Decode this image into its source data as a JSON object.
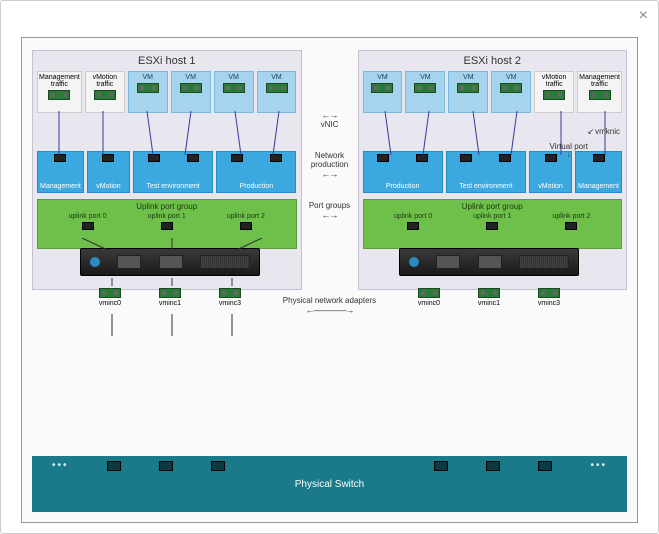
{
  "close": "×",
  "hosts": [
    {
      "title": "ESXi host 1",
      "top": [
        {
          "label": "Management traffic",
          "type": "wh"
        },
        {
          "label": "vMotion traffic",
          "type": "wh"
        },
        {
          "label": "VM",
          "type": "bl"
        },
        {
          "label": "VM",
          "type": "bl"
        },
        {
          "label": "VM",
          "type": "bl"
        },
        {
          "label": "VM",
          "type": "bl"
        }
      ],
      "portgroups": [
        {
          "label": "Management",
          "ports": 1
        },
        {
          "label": "vMotion",
          "ports": 1
        },
        {
          "label": "Test environment",
          "ports": 2
        },
        {
          "label": "Production",
          "ports": 2
        }
      ],
      "uplink": {
        "title": "Uplink port group",
        "items": [
          "uplink port 0",
          "uplink port 1",
          "uplink port 2"
        ]
      }
    },
    {
      "title": "ESXi host 2",
      "top": [
        {
          "label": "VM",
          "type": "bl"
        },
        {
          "label": "VM",
          "type": "bl"
        },
        {
          "label": "VM",
          "type": "bl"
        },
        {
          "label": "VM",
          "type": "bl"
        },
        {
          "label": "vMotion traffic",
          "type": "wh"
        },
        {
          "label": "Management traffic",
          "type": "wh"
        }
      ],
      "portgroups": [
        {
          "label": "Production",
          "ports": 2
        },
        {
          "label": "Test environment",
          "ports": 2
        },
        {
          "label": "vMotion",
          "ports": 1
        },
        {
          "label": "Management",
          "ports": 1
        }
      ],
      "uplink": {
        "title": "Uplink port group",
        "items": [
          "uplink port 0",
          "uplink port 1",
          "uplink port 2"
        ]
      }
    }
  ],
  "center": {
    "vnic": "vNIC",
    "netprod": "Network production",
    "portgroups": "Port groups"
  },
  "vmknic": "vmknic",
  "vport": "Virtual port",
  "pna_label": "Physical network adapters",
  "pna": [
    "vminc0",
    "vminc1",
    "vminc3"
  ],
  "pswitch": "Physical Switch",
  "chart_data": {
    "type": "network-topology",
    "title": "vSphere Distributed Switch architecture",
    "hosts": [
      "ESXi host 1",
      "ESXi host 2"
    ],
    "vm_traffic_types": [
      "Management traffic",
      "vMotion traffic",
      "VM"
    ],
    "port_groups": [
      "Management",
      "vMotion",
      "Test environment",
      "Production"
    ],
    "uplink_group": "Uplink port group",
    "uplinks_per_host": [
      "uplink port 0",
      "uplink port 1",
      "uplink port 2"
    ],
    "physical_adapters_per_host": [
      "vminc0",
      "vminc1",
      "vminc3"
    ],
    "annotations": [
      "vNIC",
      "Network production",
      "Port groups",
      "vmknic",
      "Virtual port",
      "Physical network adapters"
    ],
    "physical_switch": "Physical Switch"
  }
}
